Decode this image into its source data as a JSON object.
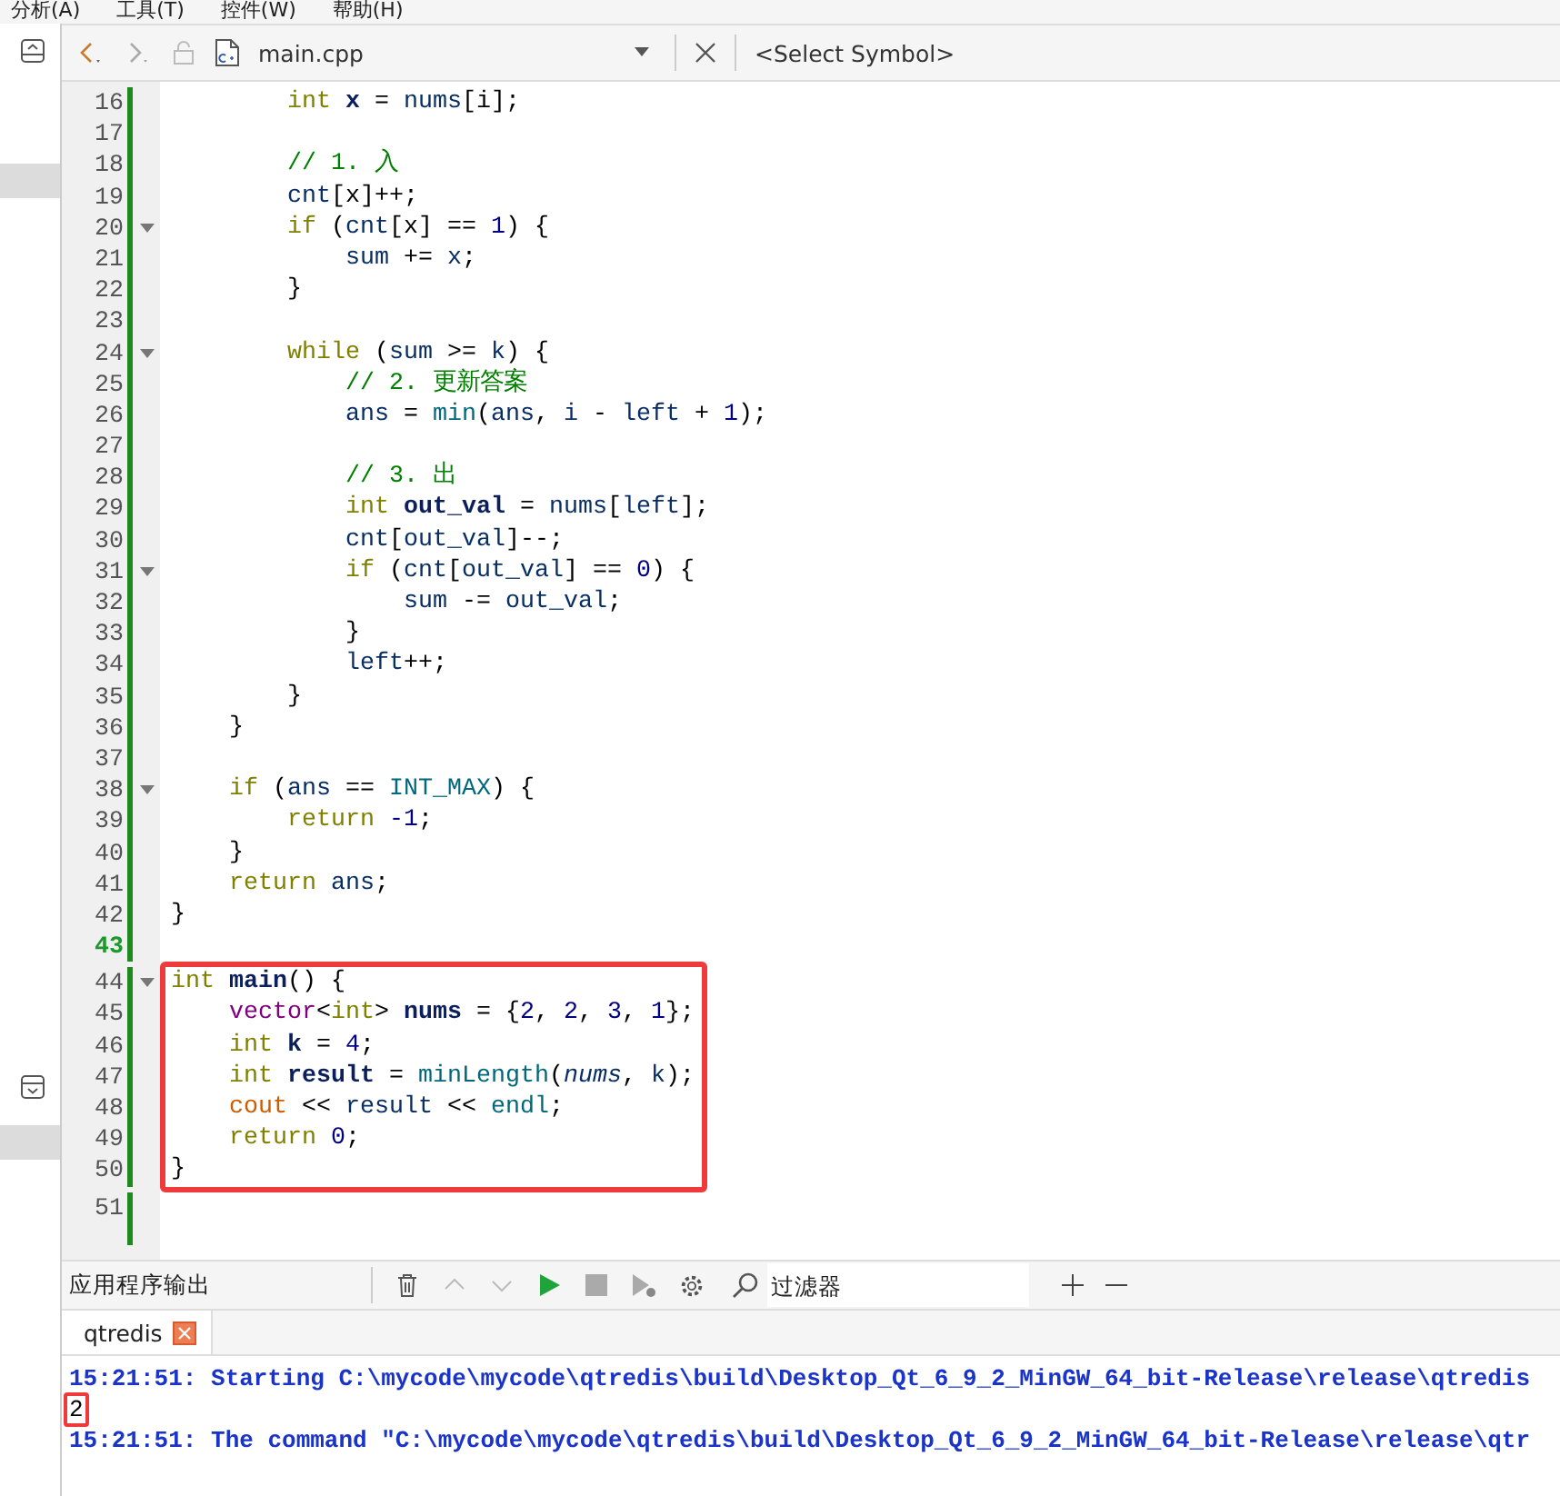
{
  "menu": [
    "分析(A)",
    "工具(T)",
    "控件(W)",
    "帮助(H)"
  ],
  "editor_toolbar": {
    "file": "main.cpp",
    "symbol": "<Select Symbol>"
  },
  "editor": {
    "blocks": [
      {
        "framed": false,
        "lines": [
          {
            "number": "16",
            "tokens": [
              {
                "t": "        int",
                "kind": "kw"
              },
              {
                "t": " x",
                "kind": "decl"
              },
              {
                "t": " = "
              },
              {
                "t": "nums",
                "kind": "var"
              },
              {
                "t": "[i];"
              }
            ]
          },
          {
            "number": "17"
          },
          {
            "number": "18",
            "tokens": [
              {
                "t": "        // 1. 入",
                "kind": "comment"
              }
            ]
          },
          {
            "number": "19",
            "tokens": [
              {
                "t": "        cnt",
                "kind": "var"
              },
              {
                "t": "[x]++;"
              }
            ]
          },
          {
            "number": "20",
            "fold": true,
            "tokens": [
              {
                "t": "        if",
                "kind": "kw"
              },
              {
                "t": " ("
              },
              {
                "t": "cnt",
                "kind": "var"
              },
              {
                "t": "[x] == "
              },
              {
                "t": "1",
                "kind": "num"
              },
              {
                "t": ") {"
              }
            ]
          },
          {
            "number": "21",
            "tokens": [
              {
                "t": "            sum",
                "kind": "var"
              },
              {
                "t": " += "
              },
              {
                "t": "x",
                "kind": "var"
              },
              {
                "t": ";"
              }
            ]
          },
          {
            "number": "22",
            "tokens": [
              {
                "t": "        }"
              }
            ]
          },
          {
            "number": "23"
          },
          {
            "number": "24",
            "fold": true,
            "tokens": [
              {
                "t": "        while",
                "kind": "kw"
              },
              {
                "t": " ("
              },
              {
                "t": "sum",
                "kind": "var"
              },
              {
                "t": " >= "
              },
              {
                "t": "k",
                "kind": "var"
              },
              {
                "t": ") {"
              }
            ]
          },
          {
            "number": "25",
            "tokens": [
              {
                "t": "            // 2. 更新答案",
                "kind": "comment"
              }
            ]
          },
          {
            "number": "26",
            "tokens": [
              {
                "t": "            ans",
                "kind": "var"
              },
              {
                "t": " = "
              },
              {
                "t": "min",
                "kind": "func"
              },
              {
                "t": "("
              },
              {
                "t": "ans",
                "kind": "var"
              },
              {
                "t": ", "
              },
              {
                "t": "i",
                "kind": "var"
              },
              {
                "t": " - "
              },
              {
                "t": "left",
                "kind": "var"
              },
              {
                "t": " + "
              },
              {
                "t": "1",
                "kind": "num"
              },
              {
                "t": ");"
              }
            ]
          },
          {
            "number": "27"
          },
          {
            "number": "28",
            "tokens": [
              {
                "t": "            // 3. 出",
                "kind": "comment"
              }
            ]
          },
          {
            "number": "29",
            "tokens": [
              {
                "t": "            int",
                "kind": "kw"
              },
              {
                "t": " out_val",
                "kind": "decl"
              },
              {
                "t": " = "
              },
              {
                "t": "nums",
                "kind": "var"
              },
              {
                "t": "["
              },
              {
                "t": "left",
                "kind": "var"
              },
              {
                "t": "];"
              }
            ]
          },
          {
            "number": "30",
            "tokens": [
              {
                "t": "            cnt",
                "kind": "var"
              },
              {
                "t": "["
              },
              {
                "t": "out_val",
                "kind": "var"
              },
              {
                "t": "]--;"
              }
            ]
          },
          {
            "number": "31",
            "fold": true,
            "tokens": [
              {
                "t": "            if",
                "kind": "kw"
              },
              {
                "t": " ("
              },
              {
                "t": "cnt",
                "kind": "var"
              },
              {
                "t": "["
              },
              {
                "t": "out_val",
                "kind": "var"
              },
              {
                "t": "] == "
              },
              {
                "t": "0",
                "kind": "num"
              },
              {
                "t": ") {"
              }
            ]
          },
          {
            "number": "32",
            "tokens": [
              {
                "t": "                sum",
                "kind": "var"
              },
              {
                "t": " -= "
              },
              {
                "t": "out_val",
                "kind": "var"
              },
              {
                "t": ";"
              }
            ]
          },
          {
            "number": "33",
            "tokens": [
              {
                "t": "            }"
              }
            ]
          },
          {
            "number": "34",
            "tokens": [
              {
                "t": "            left",
                "kind": "var"
              },
              {
                "t": "++;"
              }
            ]
          },
          {
            "number": "35",
            "tokens": [
              {
                "t": "        }"
              }
            ]
          },
          {
            "number": "36",
            "tokens": [
              {
                "t": "    }"
              }
            ]
          },
          {
            "number": "37"
          },
          {
            "number": "38",
            "fold": true,
            "tokens": [
              {
                "t": "    if",
                "kind": "kw"
              },
              {
                "t": " ("
              },
              {
                "t": "ans",
                "kind": "var"
              },
              {
                "t": " == "
              },
              {
                "t": "INT_MAX",
                "kind": "func"
              },
              {
                "t": ") {"
              }
            ]
          },
          {
            "number": "39",
            "tokens": [
              {
                "t": "        return",
                "kind": "kw"
              },
              {
                "t": " -1",
                "kind": "num"
              },
              {
                "t": ";"
              }
            ]
          },
          {
            "number": "40",
            "tokens": [
              {
                "t": "    }"
              }
            ]
          },
          {
            "number": "41",
            "tokens": [
              {
                "t": "    return",
                "kind": "kw"
              },
              {
                "t": " ans",
                "kind": "var"
              },
              {
                "t": ";"
              }
            ]
          },
          {
            "number": "42",
            "tokens": [
              {
                "t": "}"
              }
            ]
          },
          {
            "number": "43",
            "current": true
          }
        ]
      },
      {
        "framed": true,
        "lines": [
          {
            "number": "44",
            "fold": true,
            "tokens": [
              {
                "t": "int",
                "kind": "kw"
              },
              {
                "t": " main",
                "kind": "decl"
              },
              {
                "t": "() {"
              }
            ]
          },
          {
            "number": "45",
            "tokens": [
              {
                "t": "    vector",
                "kind": "type"
              },
              {
                "t": "<"
              },
              {
                "t": "int",
                "kind": "kw"
              },
              {
                "t": "> "
              },
              {
                "t": "nums",
                "kind": "decl"
              },
              {
                "t": " = {"
              },
              {
                "t": "2",
                "kind": "num"
              },
              {
                "t": ", "
              },
              {
                "t": "2",
                "kind": "num"
              },
              {
                "t": ", "
              },
              {
                "t": "3",
                "kind": "num"
              },
              {
                "t": ", "
              },
              {
                "t": "1",
                "kind": "num"
              },
              {
                "t": "};"
              }
            ]
          },
          {
            "number": "46",
            "tokens": [
              {
                "t": "    int",
                "kind": "kw"
              },
              {
                "t": " k",
                "kind": "decl"
              },
              {
                "t": " = "
              },
              {
                "t": "4",
                "kind": "num"
              },
              {
                "t": ";"
              }
            ]
          },
          {
            "number": "47",
            "tokens": [
              {
                "t": "    int",
                "kind": "kw"
              },
              {
                "t": " result",
                "kind": "decl"
              },
              {
                "t": " = "
              },
              {
                "t": "minLength",
                "kind": "func"
              },
              {
                "t": "("
              },
              {
                "t": "nums",
                "kind": "param"
              },
              {
                "t": ", "
              },
              {
                "t": "k",
                "kind": "var"
              },
              {
                "t": ");"
              }
            ]
          },
          {
            "number": "48",
            "tokens": [
              {
                "t": "    cout",
                "kind": "stream"
              },
              {
                "t": " << "
              },
              {
                "t": "result",
                "kind": "var"
              },
              {
                "t": " << "
              },
              {
                "t": "endl",
                "kind": "func"
              },
              {
                "t": ";"
              }
            ]
          },
          {
            "number": "49",
            "tokens": [
              {
                "t": "    return",
                "kind": "kw"
              },
              {
                "t": " 0",
                "kind": "num"
              },
              {
                "t": ";"
              }
            ]
          },
          {
            "number": "50",
            "tokens": [
              {
                "t": "}"
              }
            ]
          }
        ]
      },
      {
        "framed": false,
        "lines": [
          {
            "number": "51"
          }
        ]
      }
    ]
  },
  "output": {
    "title": "应用程序输出",
    "filter_placeholder": "过滤器",
    "tabs": [
      {
        "label": "qtredis",
        "selected": true
      }
    ],
    "lines": [
      {
        "kind": "status",
        "text": "15:21:51: Starting C:\\mycode\\mycode\\qtredis\\build\\Desktop_Qt_6_9_2_MinGW_64_bit-Release\\release\\qtredis"
      },
      {
        "kind": "program",
        "text": "2",
        "boxed": true
      },
      {
        "kind": "status",
        "text": "15:21:51: The command \"C:\\mycode\\mycode\\qtredis\\build\\Desktop_Qt_6_9_2_MinGW_64_bit-Release\\release\\qtr"
      }
    ]
  }
}
